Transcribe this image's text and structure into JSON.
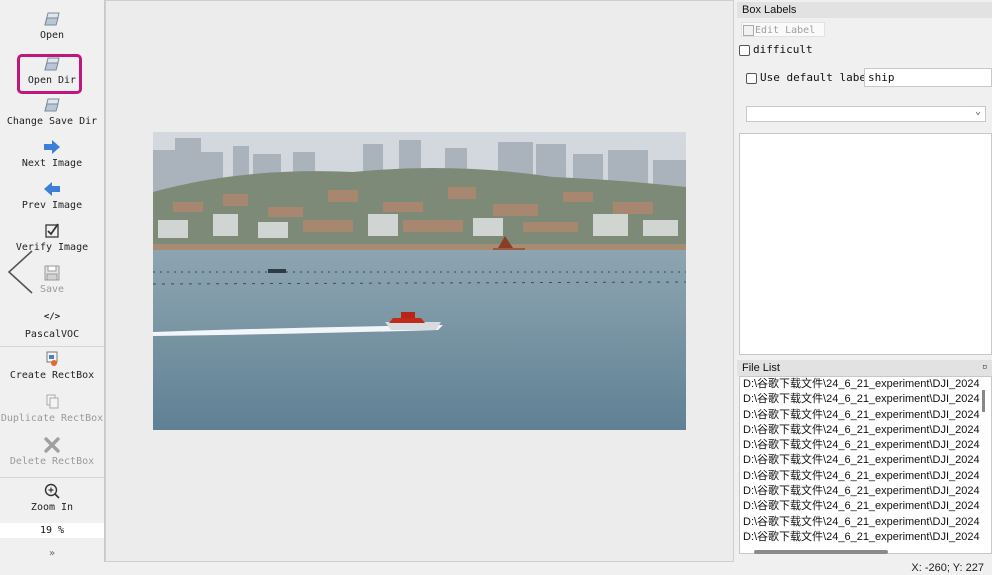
{
  "toolbar": {
    "open": "Open",
    "open_dir": "Open Dir",
    "change_save_dir": "Change Save Dir",
    "next_image": "Next Image",
    "prev_image": "Prev Image",
    "verify_image": "Verify Image",
    "save": "Save",
    "format_icon": "</>",
    "format": "PascalVOC",
    "create_rectbox": "Create RectBox",
    "duplicate_rectbox": "Duplicate RectBox",
    "delete_rectbox": "Delete RectBox",
    "zoom_in": "Zoom In",
    "zoom_value": "19 %",
    "more": "»"
  },
  "colors": {
    "highlight": "#c0187a",
    "accent_blue": "#3d7fd8"
  },
  "box_labels": {
    "title": "Box Labels",
    "edit_label": "Edit Label",
    "difficult": "difficult",
    "use_default_label": "Use default label",
    "default_label_value": "ship"
  },
  "file_list": {
    "title": "File List",
    "items": [
      "D:\\谷歌下载文件\\24_6_21_experiment\\DJI_2024",
      "D:\\谷歌下载文件\\24_6_21_experiment\\DJI_2024",
      "D:\\谷歌下载文件\\24_6_21_experiment\\DJI_2024",
      "D:\\谷歌下载文件\\24_6_21_experiment\\DJI_2024",
      "D:\\谷歌下载文件\\24_6_21_experiment\\DJI_2024",
      "D:\\谷歌下载文件\\24_6_21_experiment\\DJI_2024",
      "D:\\谷歌下载文件\\24_6_21_experiment\\DJI_2024",
      "D:\\谷歌下载文件\\24_6_21_experiment\\DJI_2024",
      "D:\\谷歌下载文件\\24_6_21_experiment\\DJI_2024",
      "D:\\谷歌下载文件\\24_6_21_experiment\\DJI_2024",
      "D:\\谷歌下载文件\\24_6_21_experiment\\DJI_2024"
    ]
  },
  "status": {
    "coords": "X: -260; Y: 227"
  }
}
